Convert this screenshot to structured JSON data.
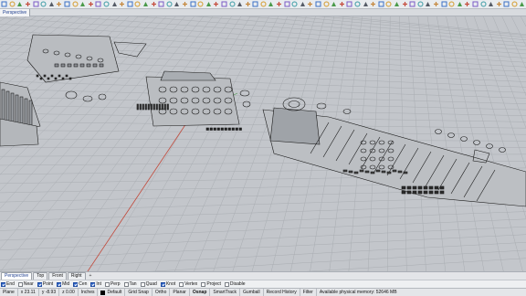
{
  "toolbar": {
    "icons": [
      "new-file",
      "open-file",
      "save-file",
      "print",
      "import",
      "cut",
      "copy",
      "paste",
      "undo",
      "redo",
      "pan",
      "rotate-view",
      "zoom",
      "zoom-window",
      "zoom-extents",
      "zoom-selected",
      "undo-view",
      "named-view",
      "viewport-layout",
      "set-view",
      "shade",
      "rendered",
      "render",
      "lights",
      "materials",
      "layer",
      "properties",
      "select-all",
      "hide",
      "show",
      "lock",
      "unlock",
      "color",
      "pointcloud",
      "line",
      "polyline",
      "curve",
      "circle",
      "arc",
      "rectangle",
      "ellipse",
      "polygon",
      "point",
      "surface",
      "extrude",
      "box",
      "sphere",
      "cylinder",
      "boolean",
      "fillet",
      "move",
      "copy-obj",
      "rotate",
      "scale",
      "mirror",
      "array",
      "join",
      "explode",
      "trim",
      "split",
      "offset",
      "dimension",
      "text",
      "hatch",
      "block",
      "analyze",
      "help"
    ]
  },
  "viewport": {
    "active_tab": "Perspective",
    "colors": {
      "grid_bg": "#c3c6cb",
      "grid_line": "#a9adb2",
      "x_axis": "#c24a3c",
      "y_axis": "#4f9a4f",
      "part_stroke": "#1a1a1a"
    }
  },
  "bottom_tabs": [
    {
      "label": "Perspective"
    },
    {
      "label": "Top"
    },
    {
      "label": "Front"
    },
    {
      "label": "Right"
    },
    {
      "label": "+"
    }
  ],
  "osnap": [
    {
      "label": "End",
      "checked": true
    },
    {
      "label": "Near",
      "checked": false
    },
    {
      "label": "Point",
      "checked": true
    },
    {
      "label": "Mid",
      "checked": true
    },
    {
      "label": "Cen",
      "checked": true
    },
    {
      "label": "Int",
      "checked": true
    },
    {
      "label": "Perp",
      "checked": false
    },
    {
      "label": "Tan",
      "checked": false
    },
    {
      "label": "Quad",
      "checked": false
    },
    {
      "label": "Knot",
      "checked": true
    },
    {
      "label": "Vertex",
      "checked": false
    },
    {
      "label": "Project",
      "checked": false
    },
    {
      "label": "Disable",
      "checked": false
    }
  ],
  "status": {
    "plane": "Plane",
    "x": "x 23.11",
    "y": "y -8.93",
    "z": "z 0.00",
    "units": "Inches",
    "layer": "Default",
    "grid_snap": "Grid Snap",
    "ortho": "Ortho",
    "planar": "Planar",
    "osnap": "Osnap",
    "smarttrack": "SmartTrack",
    "gumball": "Gumball",
    "record_history": "Record History",
    "filter": "Filter",
    "memory": "Available physical memory: 52646 MB"
  }
}
